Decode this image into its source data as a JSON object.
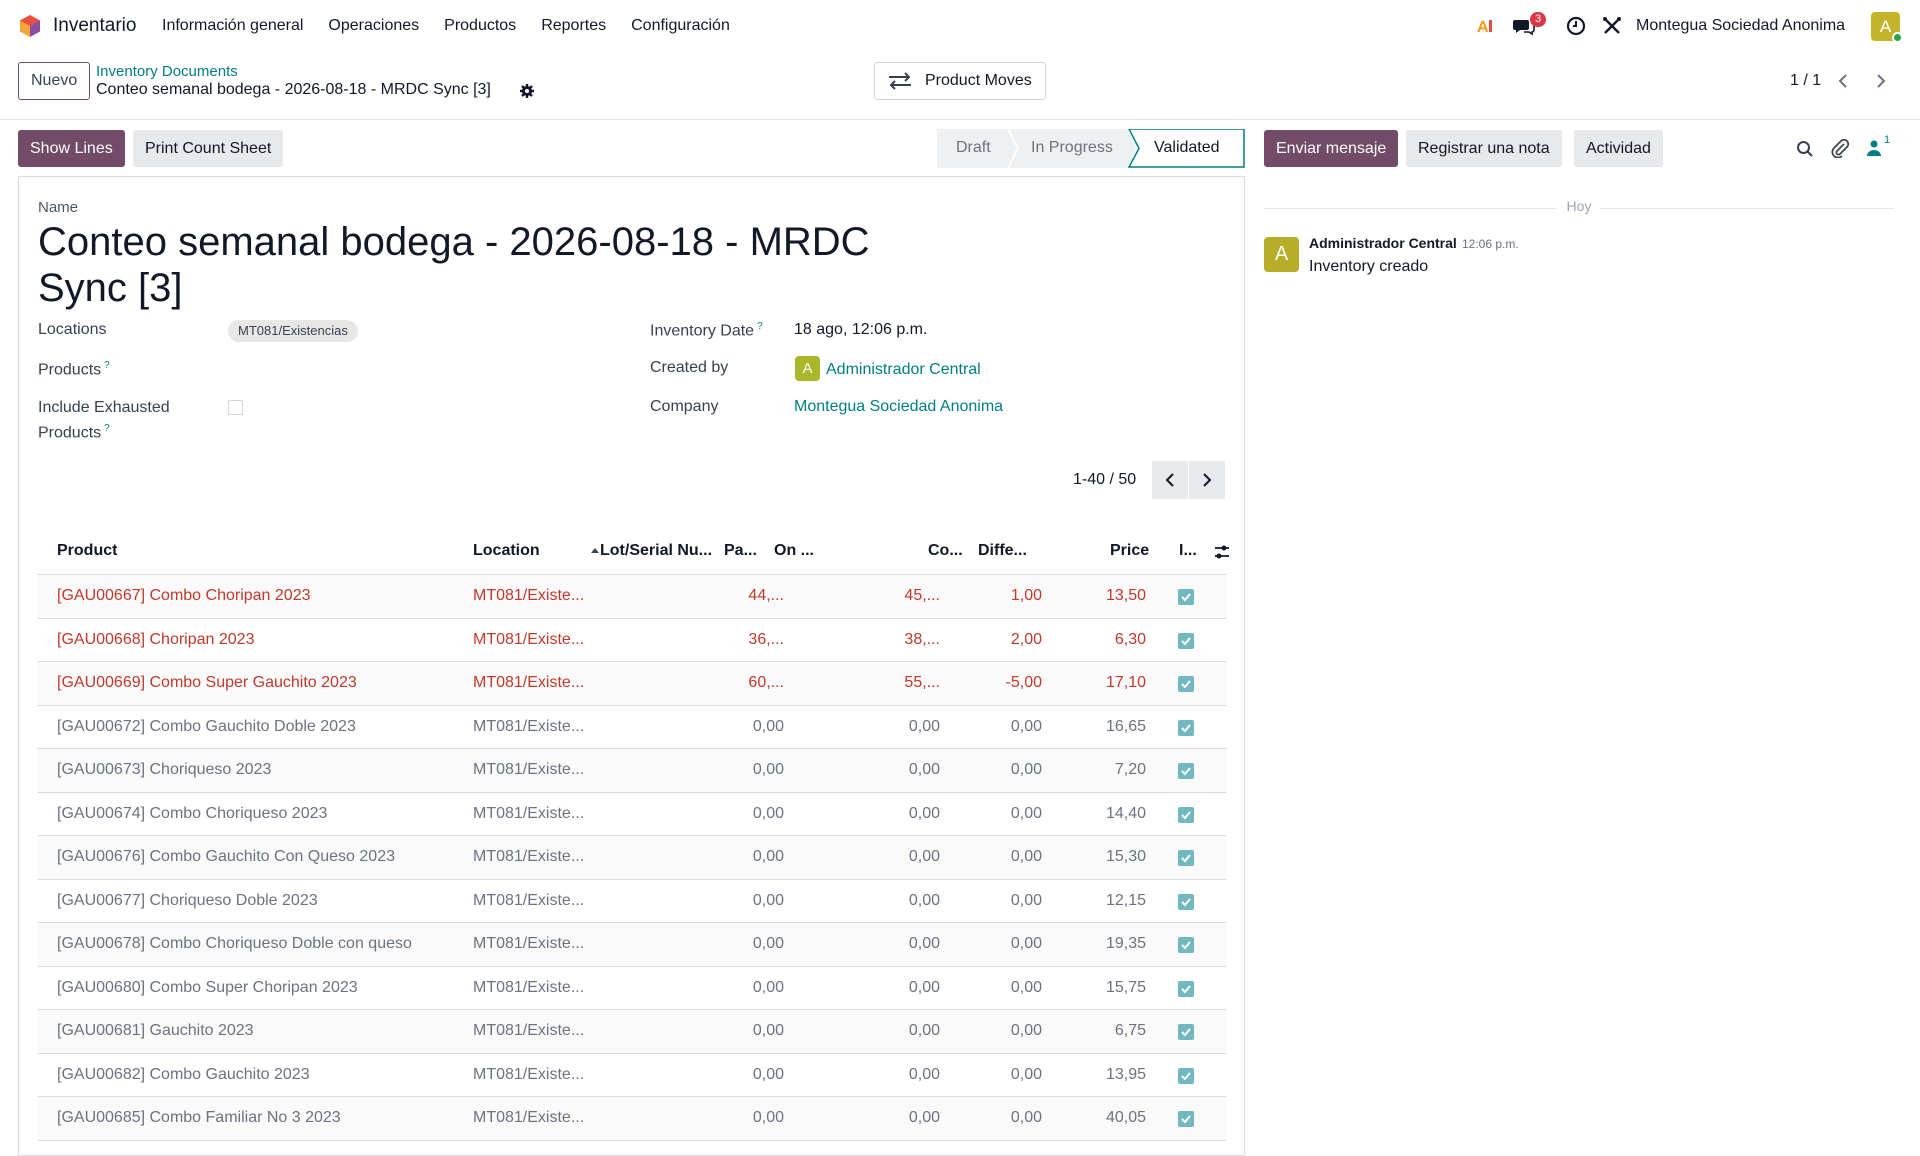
{
  "navbar": {
    "app_name": "Inventario",
    "menu": [
      "Información general",
      "Operaciones",
      "Productos",
      "Reportes",
      "Configuración"
    ],
    "messages_badge": "3",
    "company": "Montegua Sociedad Anonima",
    "user_initial": "A"
  },
  "control": {
    "new_label": "Nuevo",
    "breadcrumb_parent": "Inventory Documents",
    "breadcrumb_current": "Conteo semanal bodega - 2026-08-18 - MRDC Sync [3]",
    "product_moves_label": "Product Moves",
    "pager": "1 / 1"
  },
  "actions": {
    "show_lines": "Show Lines",
    "print_count_sheet": "Print Count Sheet",
    "statuses": [
      "Draft",
      "In Progress",
      "Validated"
    ],
    "active_status": "Validated"
  },
  "chatter": {
    "send_message": "Enviar mensaje",
    "log_note": "Registrar una nota",
    "activity": "Actividad",
    "followers_count": "1",
    "date_separator": "Hoy",
    "message": {
      "author": "Administrador Central",
      "time": "12:06 p.m.",
      "body": "Inventory creado",
      "avatar_initial": "A"
    }
  },
  "form": {
    "name_label": "Name",
    "title": "Conteo semanal bodega - 2026-08-18 - MRDC Sync [3]",
    "locations_label": "Locations",
    "location_tag": "MT081/Existencias",
    "products_label": "Products",
    "include_exhausted_label_1": "Include Exhausted",
    "include_exhausted_label_2": "Products",
    "include_exhausted_value": false,
    "inventory_date_label": "Inventory Date",
    "inventory_date_value": "18 ago, 12:06 p.m.",
    "created_by_label": "Created by",
    "created_by_value": "Administrador Central",
    "created_by_initial": "A",
    "company_label": "Company",
    "company_value": "Montegua Sociedad Anonima",
    "help_mark": "?"
  },
  "list": {
    "pager": "1-40 / 50",
    "headers": {
      "product": "Product",
      "location": "Location",
      "lot": "Lot/Serial Nu...",
      "package": "Pa...",
      "on_hand": "On ...",
      "counted": "Co...",
      "difference": "Diffe...",
      "price": "Price",
      "included": "I..."
    },
    "rows": [
      {
        "product": "[GAU00667] Combo Choripan 2023",
        "location": "MT081/Existe...",
        "on_hand": "44,...",
        "counted": "45,...",
        "difference": "1,00",
        "price": "13,50",
        "included": true,
        "highlight": true
      },
      {
        "product": "[GAU00668] Choripan 2023",
        "location": "MT081/Existe...",
        "on_hand": "36,...",
        "counted": "38,...",
        "difference": "2,00",
        "price": "6,30",
        "included": true,
        "highlight": true
      },
      {
        "product": "[GAU00669] Combo Super Gauchito 2023",
        "location": "MT081/Existe...",
        "on_hand": "60,...",
        "counted": "55,...",
        "difference": "-5,00",
        "price": "17,10",
        "included": true,
        "highlight": true
      },
      {
        "product": "[GAU00672] Combo Gauchito Doble 2023",
        "location": "MT081/Existe...",
        "on_hand": "0,00",
        "counted": "0,00",
        "difference": "0,00",
        "price": "16,65",
        "included": true,
        "highlight": false
      },
      {
        "product": "[GAU00673] Choriqueso 2023",
        "location": "MT081/Existe...",
        "on_hand": "0,00",
        "counted": "0,00",
        "difference": "0,00",
        "price": "7,20",
        "included": true,
        "highlight": false
      },
      {
        "product": "[GAU00674] Combo Choriqueso 2023",
        "location": "MT081/Existe...",
        "on_hand": "0,00",
        "counted": "0,00",
        "difference": "0,00",
        "price": "14,40",
        "included": true,
        "highlight": false
      },
      {
        "product": "[GAU00676] Combo Gauchito Con Queso 2023",
        "location": "MT081/Existe...",
        "on_hand": "0,00",
        "counted": "0,00",
        "difference": "0,00",
        "price": "15,30",
        "included": true,
        "highlight": false
      },
      {
        "product": "[GAU00677] Choriqueso Doble 2023",
        "location": "MT081/Existe...",
        "on_hand": "0,00",
        "counted": "0,00",
        "difference": "0,00",
        "price": "12,15",
        "included": true,
        "highlight": false
      },
      {
        "product": "[GAU00678] Combo Choriqueso Doble con queso",
        "location": "MT081/Existe...",
        "on_hand": "0,00",
        "counted": "0,00",
        "difference": "0,00",
        "price": "19,35",
        "included": true,
        "highlight": false
      },
      {
        "product": "[GAU00680] Combo Super Choripan 2023",
        "location": "MT081/Existe...",
        "on_hand": "0,00",
        "counted": "0,00",
        "difference": "0,00",
        "price": "15,75",
        "included": true,
        "highlight": false
      },
      {
        "product": "[GAU00681] Gauchito 2023",
        "location": "MT081/Existe...",
        "on_hand": "0,00",
        "counted": "0,00",
        "difference": "0,00",
        "price": "6,75",
        "included": true,
        "highlight": false
      },
      {
        "product": "[GAU00682] Combo Gauchito 2023",
        "location": "MT081/Existe...",
        "on_hand": "0,00",
        "counted": "0,00",
        "difference": "0,00",
        "price": "13,95",
        "included": true,
        "highlight": false
      },
      {
        "product": "[GAU00685] Combo Familiar No 3 2023",
        "location": "MT081/Existe...",
        "on_hand": "0,00",
        "counted": "0,00",
        "difference": "0,00",
        "price": "40,05",
        "included": true,
        "highlight": false
      }
    ]
  },
  "colors": {
    "primary": "#714b67",
    "link": "#017e84",
    "danger_row": "#c0392b",
    "checkbox": "#71b8c0"
  }
}
